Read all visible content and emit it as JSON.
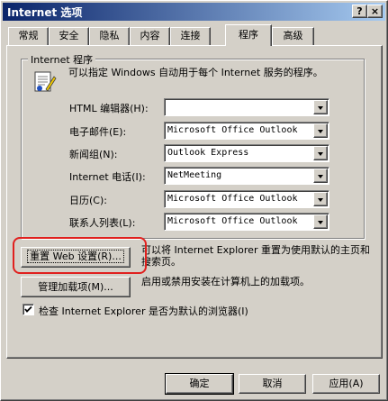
{
  "window": {
    "title": "Internet 选项",
    "help_label": "?",
    "close_label": "×"
  },
  "tabs": [
    {
      "label": "常规"
    },
    {
      "label": "安全"
    },
    {
      "label": "隐私"
    },
    {
      "label": "内容"
    },
    {
      "label": "连接"
    },
    {
      "label": "程序"
    },
    {
      "label": "高级"
    }
  ],
  "active_tab": "程序",
  "programs_group": {
    "title": "Internet 程序",
    "description": "可以指定 Windows 自动用于每个 Internet 服务的程序。",
    "rows": [
      {
        "label": "HTML 编辑器(H):",
        "value": ""
      },
      {
        "label": "电子邮件(E):",
        "value": "Microsoft Office Outlook"
      },
      {
        "label": "新闻组(N):",
        "value": "Outlook Express"
      },
      {
        "label": "Internet 电话(I):",
        "value": "NetMeeting"
      },
      {
        "label": "日历(C):",
        "value": "Microsoft Office Outlook"
      },
      {
        "label": "联系人列表(L):",
        "value": "Microsoft Office Outlook"
      }
    ]
  },
  "reset_web": {
    "button_label": "重置 Web 设置(R)...",
    "description": "可以将 Internet Explorer 重置为使用默认的主页和搜索页。"
  },
  "manage_addons": {
    "button_label": "管理加载项(M)...",
    "description": "启用或禁用安装在计算机上的加载项。"
  },
  "default_browser_check": {
    "label": "检查 Internet Explorer 是否为默认的浏览器(I)",
    "checked": true
  },
  "footer": {
    "ok_label": "确定",
    "cancel_label": "取消",
    "apply_label": "应用(A)"
  }
}
